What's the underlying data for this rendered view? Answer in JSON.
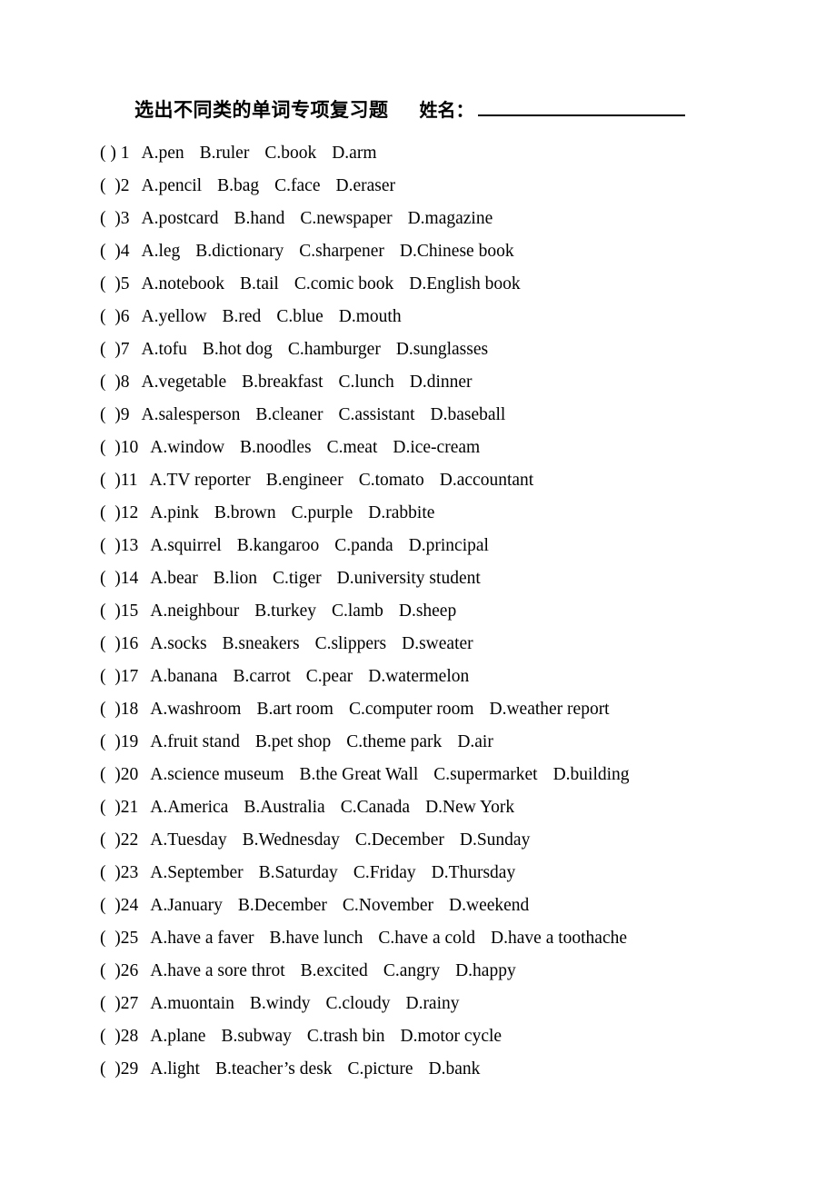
{
  "document": {
    "title": "选出不同类的单词专项复习题",
    "name_label": "姓名：",
    "name_value": "",
    "bracket_open": "(",
    "bracket_close": ")"
  },
  "questions": [
    {
      "number": "1",
      "lead": "( ) 1",
      "options": [
        "A.pen",
        "B.ruler",
        "C.book",
        "D.arm"
      ]
    },
    {
      "number": "2",
      "lead": "(  )2",
      "options": [
        "A.pencil",
        "B.bag",
        "C.face",
        "D.eraser"
      ]
    },
    {
      "number": "3",
      "lead": "(  )3",
      "options": [
        "A.postcard",
        "B.hand",
        "C.newspaper",
        "D.magazine"
      ]
    },
    {
      "number": "4",
      "lead": "(  )4",
      "options": [
        "A.leg",
        "B.dictionary",
        "C.sharpener",
        "D.Chinese book"
      ]
    },
    {
      "number": "5",
      "lead": "(  )5",
      "options": [
        "A.notebook",
        "B.tail",
        "C.comic book",
        "D.English book"
      ]
    },
    {
      "number": "6",
      "lead": "(  )6",
      "options": [
        "A.yellow",
        "B.red",
        "C.blue",
        "D.mouth"
      ]
    },
    {
      "number": "7",
      "lead": "(  )7",
      "options": [
        "A.tofu",
        "B.hot dog",
        "C.hamburger",
        "D.sunglasses"
      ]
    },
    {
      "number": "8",
      "lead": "(  )8",
      "options": [
        "A.vegetable",
        "B.breakfast",
        "C.lunch",
        "D.dinner"
      ]
    },
    {
      "number": "9",
      "lead": "(  )9",
      "options": [
        "A.salesperson",
        "B.cleaner",
        "C.assistant",
        "D.baseball"
      ]
    },
    {
      "number": "10",
      "lead": "(  )10",
      "options": [
        "A.window",
        "B.noodles",
        "C.meat",
        "D.ice-cream"
      ]
    },
    {
      "number": "11",
      "lead": "(  )11",
      "options": [
        "A.TV reporter",
        "B.engineer",
        "C.tomato",
        "D.accountant"
      ]
    },
    {
      "number": "12",
      "lead": "(  )12",
      "options": [
        "A.pink",
        "B.brown",
        "C.purple",
        "D.rabbite"
      ]
    },
    {
      "number": "13",
      "lead": "(  )13",
      "options": [
        "A.squirrel",
        "B.kangaroo",
        "C.panda",
        "D.principal"
      ]
    },
    {
      "number": "14",
      "lead": "(  )14",
      "options": [
        "A.bear",
        "B.lion",
        "C.tiger",
        "D.university student"
      ]
    },
    {
      "number": "15",
      "lead": "(  )15",
      "options": [
        "A.neighbour",
        "B.turkey",
        "C.lamb",
        "D.sheep"
      ]
    },
    {
      "number": "16",
      "lead": "(  )16",
      "options": [
        "A.socks",
        "B.sneakers",
        "C.slippers",
        "D.sweater"
      ]
    },
    {
      "number": "17",
      "lead": "(  )17",
      "options": [
        "A.banana",
        "B.carrot",
        "C.pear",
        "D.watermelon"
      ]
    },
    {
      "number": "18",
      "lead": "(  )18",
      "options": [
        "A.washroom",
        "B.art room",
        "C.computer room",
        "D.weather report"
      ]
    },
    {
      "number": "19",
      "lead": "(  )19",
      "options": [
        "A.fruit stand",
        "B.pet shop",
        "C.theme park",
        "D.air"
      ]
    },
    {
      "number": "20",
      "lead": "(  )20",
      "options": [
        "A.science museum",
        "B.the Great Wall",
        "C.supermarket",
        "D.building"
      ]
    },
    {
      "number": "21",
      "lead": "(  )21",
      "options": [
        "A.America",
        "B.Australia",
        "C.Canada",
        "D.New York"
      ]
    },
    {
      "number": "22",
      "lead": "(  )22",
      "options": [
        "A.Tuesday",
        "B.Wednesday",
        "C.December",
        "D.Sunday"
      ]
    },
    {
      "number": "23",
      "lead": "(  )23",
      "options": [
        "A.September",
        "B.Saturday",
        "C.Friday",
        "D.Thursday"
      ]
    },
    {
      "number": "24",
      "lead": "(  )24",
      "options": [
        "A.January",
        "B.December",
        "C.November",
        "D.weekend"
      ]
    },
    {
      "number": "25",
      "lead": "(  )25",
      "options": [
        "A.have a faver",
        "B.have lunch",
        "C.have a cold",
        "D.have a toothache"
      ]
    },
    {
      "number": "26",
      "lead": "(  )26",
      "options": [
        "A.have a sore throt",
        "B.excited",
        "C.angry",
        "D.happy"
      ]
    },
    {
      "number": "27",
      "lead": "(  )27",
      "options": [
        "A.muontain",
        "B.windy",
        "C.cloudy",
        "D.rainy"
      ]
    },
    {
      "number": "28",
      "lead": "(  )28",
      "options": [
        "A.plane",
        "B.subway",
        "C.trash bin",
        "D.motor cycle"
      ]
    },
    {
      "number": "29",
      "lead": "(  )29",
      "options": [
        "A.light",
        "B.teacher’s desk",
        "C.picture",
        "D.bank"
      ]
    }
  ]
}
